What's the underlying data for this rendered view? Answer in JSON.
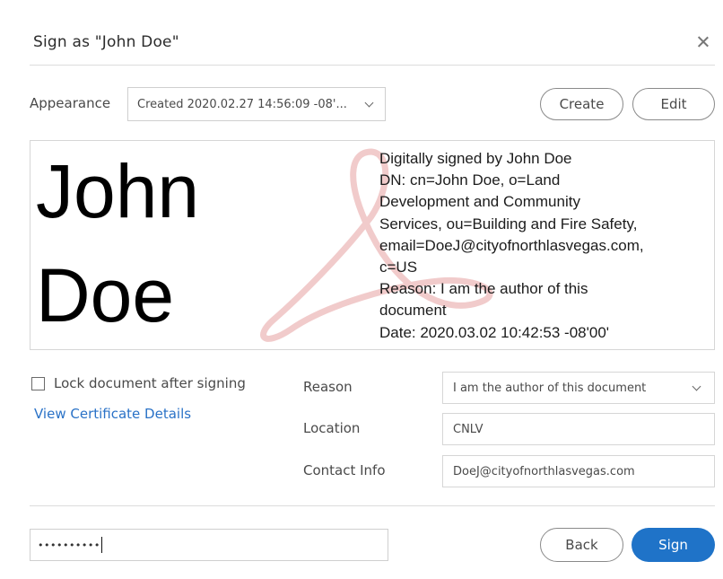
{
  "dialog": {
    "title": "Sign as \"John Doe\"",
    "close_icon": "close-icon"
  },
  "appearance": {
    "label": "Appearance",
    "selected": "Created 2020.02.27 14:56:09 -08'...",
    "create_label": "Create",
    "edit_label": "Edit"
  },
  "preview": {
    "name_line1": "John",
    "name_line2": "Doe",
    "watermark_icon": "acrobat-logo-watermark",
    "watermark_color": "#e8a9a9",
    "details": [
      "Digitally signed by John Doe",
      "DN: cn=John Doe, o=Land",
      "Development and Community",
      "Services, ou=Building and Fire Safety,",
      "email=DoeJ@cityofnorthlasvegas.com,",
      "c=US",
      "Reason: I am the author of this",
      "document",
      "Date: 2020.03.02 10:42:53 -08'00'"
    ]
  },
  "options": {
    "lock_label": "Lock document after signing",
    "lock_checked": false,
    "cert_link": "View Certificate Details"
  },
  "fields": {
    "reason_label": "Reason",
    "reason_value": "I am the author of this document",
    "location_label": "Location",
    "location_value": "CNLV",
    "contact_label": "Contact Info",
    "contact_value": "DoeJ@cityofnorthlasvegas.com"
  },
  "footer": {
    "password_value": "••••••••••",
    "back_label": "Back",
    "sign_label": "Sign"
  },
  "colors": {
    "accent": "#1f73c8",
    "link": "#2a72c7"
  }
}
